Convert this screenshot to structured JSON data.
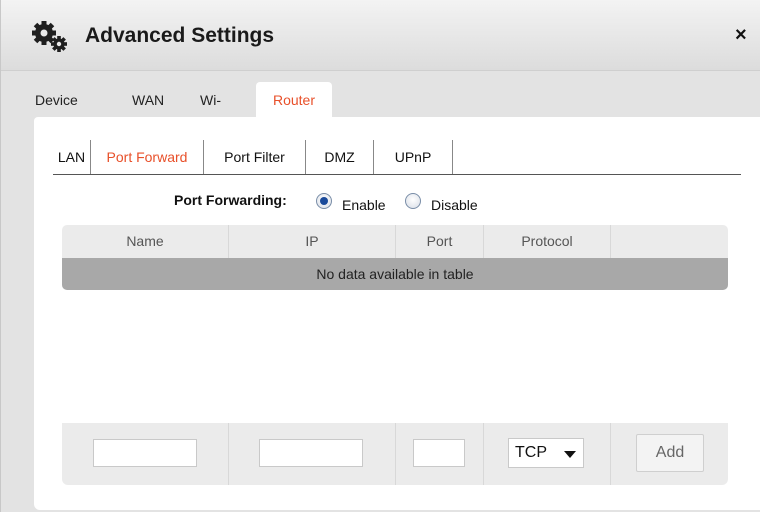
{
  "dialog": {
    "title": "Advanced Settings",
    "close_symbol": "×",
    "title_icon": "gears-icon"
  },
  "top_tabs": [
    "Device",
    "WAN",
    "Wi-Fi",
    "Router"
  ],
  "active_top_tab": "Router",
  "sub_tabs": [
    "LAN",
    "Port Forward",
    "Port Filter",
    "DMZ",
    "UPnP"
  ],
  "active_sub_tab": "Port Forward",
  "port_forwarding": {
    "label": "Port Forwarding:",
    "enable_label": "Enable",
    "disable_label": "Disable",
    "selected": "Enable"
  },
  "table": {
    "columns": [
      "Name",
      "IP",
      "Port",
      "Protocol",
      ""
    ],
    "empty_text": "No data available in table"
  },
  "add_row": {
    "name_value": "",
    "ip_value": "",
    "port_value": "",
    "protocol_selected": "TCP",
    "add_label": "Add"
  },
  "colors": {
    "accent": "#e8502a",
    "radio_selected": "#1a4a9a",
    "empty_row_bg": "#a8a8a8"
  }
}
